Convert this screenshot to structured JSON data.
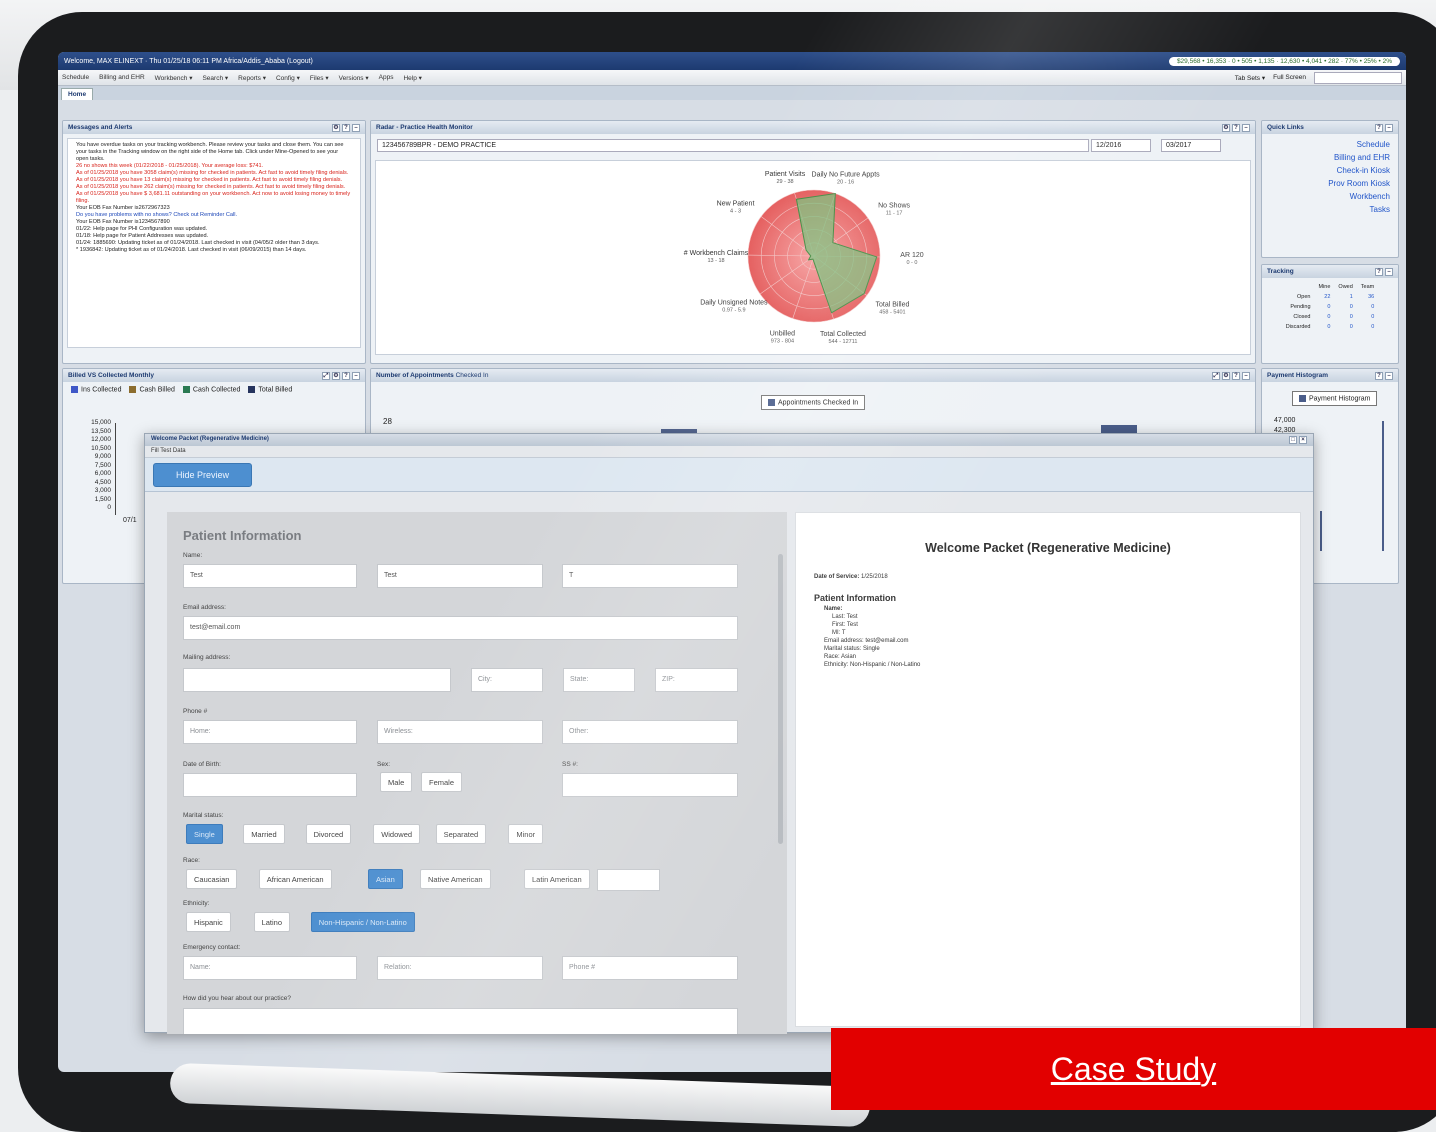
{
  "topbar": {
    "welcome": "Welcome, MAX ELINEXT · Thu 01/25/18 06:11 PM Africa/Addis_Ababa (Logout)",
    "stats": "$29,568 • 16,353 · 0 • 505 • 1,135 · 12,630 • 4,041 • 282 · 77% • 25% • 2%"
  },
  "menu": {
    "items": [
      "Schedule",
      "Billing and EHR",
      "Workbench ▾",
      "Search ▾",
      "Reports ▾",
      "Config ▾",
      "Files ▾",
      "Versions ▾",
      "Apps",
      "Help ▾"
    ],
    "tab_sets": "Tab Sets ▾",
    "full_screen": "Full Screen"
  },
  "tabs": {
    "home": "Home"
  },
  "messages": {
    "title": "Messages and Alerts",
    "items": [
      {
        "text": "You have overdue tasks on your tracking workbench. Please review your tasks and close them. You can see your tasks in the Tracking window on the right side of the Home tab. Click under Mine-Opened to see your open tasks.",
        "style": "normal"
      },
      {
        "text": "26 no shows this week (01/22/2018 - 01/25/2018). Your average loss: $741.",
        "style": "red"
      },
      {
        "text": "As of 01/25/2018 you have 3058 claim(s) missing for checked in patients. Act fast to avoid timely filing denials.",
        "style": "red"
      },
      {
        "text": "As of 01/25/2018 you have 13 claim(s) missing for checked in patients. Act fast to avoid timely filing denials.",
        "style": "red"
      },
      {
        "text": "As of 01/25/2018 you have 262 claim(s) missing for checked in patients. Act fast to avoid timely filing denials.",
        "style": "red"
      },
      {
        "text": "As of 01/25/2018 you have $ 3,681.11 outstanding on your workbench. Act now to avoid losing money to timely filing.",
        "style": "red"
      },
      {
        "text": "Your EOB Fax Number is2672967323",
        "style": "normal"
      },
      {
        "text": "Do you have problems with no shows? Check out Reminder Call.",
        "style": "blue"
      },
      {
        "text": "Your EOB Fax Number is1234567890",
        "style": "normal"
      },
      {
        "text": "01/22: Help page for PHI Configuration was updated.",
        "style": "normal"
      },
      {
        "text": "01/18: Help page for Patient Addresses was updated.",
        "style": "normal"
      },
      {
        "text": "01/24: 1885690: Updating ticket as of 01/24/2018. Last checked in visit (04/05/2 older than 3 days.",
        "style": "normal"
      },
      {
        "text": "* 1936842: Updating ticket as of 01/24/2018. Last checked in visit (06/09/2015) than 14 days.",
        "style": "normal"
      }
    ]
  },
  "radar": {
    "title": "Radar - Practice Health Monitor",
    "practice": "123456789BPR - DEMO PRACTICE",
    "date_from": "12/2016",
    "date_to": "03/2017",
    "axes": [
      {
        "label": "Patient Visits",
        "range": "29 - 38"
      },
      {
        "label": "Daily No Future Appts",
        "range": "20 - 16"
      },
      {
        "label": "No Shows",
        "range": "11 - 17"
      },
      {
        "label": "AR 120",
        "range": "0 - 0"
      },
      {
        "label": "Total Billed",
        "range": "458 - 5401"
      },
      {
        "label": "Total Collected",
        "range": "544 - 12711"
      },
      {
        "label": "Unbilled",
        "range": "973 - 804"
      },
      {
        "label": "Daily Unsigned Notes",
        "range": "0.97 - 5.9"
      },
      {
        "label": "# Workbench Claims",
        "range": "13 - 18"
      },
      {
        "label": "New Patient",
        "range": "4 - 3"
      }
    ]
  },
  "quick_links": {
    "title": "Quick Links",
    "items": [
      "Schedule",
      "Billing and EHR",
      "Check-in Kiosk",
      "Prov Room Kiosk",
      "Workbench",
      "Tasks"
    ]
  },
  "tracking": {
    "title": "Tracking",
    "cols": [
      "Mine",
      "Owed",
      "Team"
    ],
    "rows": [
      {
        "label": "Open",
        "vals": [
          "22",
          "1",
          "36"
        ]
      },
      {
        "label": "Pending",
        "vals": [
          "0",
          "0",
          "0"
        ]
      },
      {
        "label": "Closed",
        "vals": [
          "0",
          "0",
          "0"
        ]
      },
      {
        "label": "Discarded",
        "vals": [
          "0",
          "0",
          "0"
        ]
      }
    ]
  },
  "billed": {
    "title": "Billed VS Collected Monthly",
    "legend": [
      "Ins Collected",
      "Cash Billed",
      "Cash Collected",
      "Total Billed"
    ],
    "colors": [
      "#3f57c7",
      "#8c6d2e",
      "#2a7a52",
      "#26345e"
    ],
    "yticks": [
      "15,000",
      "13,500",
      "12,000",
      "10,500",
      "9,000",
      "7,500",
      "6,000",
      "4,500",
      "3,000",
      "1,500",
      "0"
    ],
    "xtick": "07/1"
  },
  "appointments": {
    "title": "Number of Appointments",
    "subtitle": "Checked In",
    "legend": "Appointments Checked In",
    "ytick": "28"
  },
  "payment": {
    "title": "Payment Histogram",
    "legend": "Payment Histogram",
    "ytick": "47,000",
    "ytick2": "42,300"
  },
  "modal": {
    "title": "Welcome Packet (Regenerative Medicine)",
    "sub": "Fill Test Data",
    "hide_preview": "Hide Preview",
    "form": {
      "heading": "Patient Information",
      "name_label": "Name:",
      "last": "Test",
      "first": "Test",
      "mi": "T",
      "email_label": "Email address:",
      "email": "test@email.com",
      "mailing_label": "Mailing address:",
      "city_ph": "City:",
      "state_ph": "State:",
      "zip_ph": "ZIP:",
      "phone_label": "Phone #",
      "home_ph": "Home:",
      "wireless_ph": "Wireless:",
      "other_ph": "Other:",
      "dob_label": "Date of Birth:",
      "sex_label": "Sex:",
      "ss_label": "SS #:",
      "sex_opts": [
        "Male",
        "Female"
      ],
      "marital_label": "Marital status:",
      "marital_opts": [
        "Single",
        "Married",
        "Divorced",
        "Widowed",
        "Separated",
        "Minor"
      ],
      "race_label": "Race:",
      "race_opts": [
        "Caucasian",
        "African American",
        "Asian",
        "Native American",
        "Latin American",
        "Other"
      ],
      "ethnicity_label": "Ethnicity:",
      "ethnicity_opts": [
        "Hispanic",
        "Latino",
        "Non-Hispanic / Non-Latino"
      ],
      "emergency_label": "Emergency contact:",
      "em_name_ph": "Name:",
      "em_relation_ph": "Relation:",
      "em_phone_ph": "Phone #",
      "hear_label": "How did you hear about our practice?"
    },
    "preview": {
      "title": "Welcome Packet (Regenerative Medicine)",
      "dos_label": "Date of Service:",
      "dos": "1/25/2018",
      "section": "Patient Information",
      "name_label": "Name:",
      "last": "Last: Test",
      "first": "First: Test",
      "mi": "MI: T",
      "email": "Email address: test@email.com",
      "marital": "Marital status: Single",
      "race": "Race: Asian",
      "ethnicity": "Ethnicity: Non-Hispanic / Non-Latino"
    }
  },
  "cta": {
    "label": "Case Study"
  }
}
